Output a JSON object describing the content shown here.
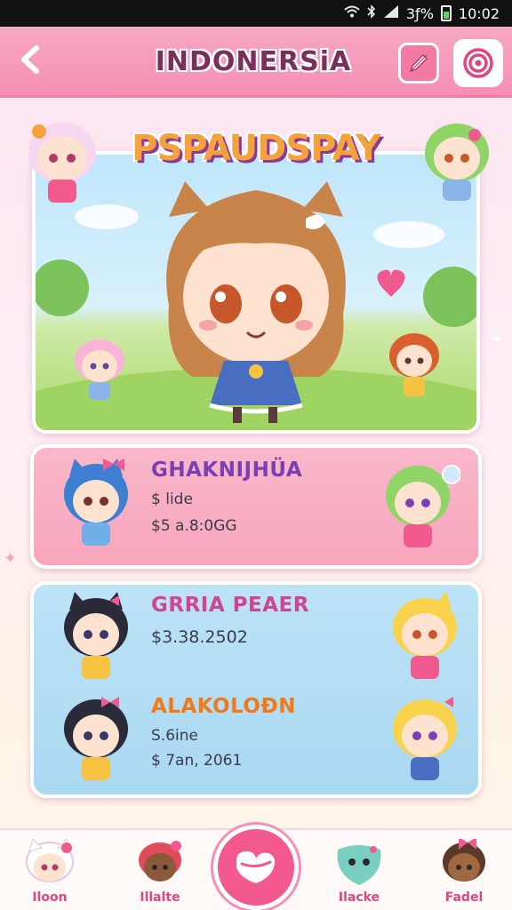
{
  "status_bar": {
    "battery_text": "3ƒ%",
    "time": "10:02",
    "wifi_icon": "wifi-icon",
    "bluetooth_icon": "bluetooth-icon",
    "signal_icon": "signal-icon"
  },
  "header": {
    "title": "INDONERSiA",
    "back_icon": "chevron-left-icon",
    "edit_icon": "pencil-icon",
    "target_icon": "target-icon"
  },
  "hero": {
    "title": "PSPAUDSPAY"
  },
  "entries": [
    {
      "name": "GHAKNIJHÜA",
      "line1": "$ lide",
      "line2": "$5 a.8:0GG",
      "card": "pink"
    },
    {
      "name": "GRRIA PEAER",
      "line1": "$3.38.2502",
      "line2": "",
      "card": "blue"
    },
    {
      "name": "ALAKOLOÐN",
      "line1": "S.6ine",
      "line2": "$ 7an, 2061",
      "card": "blue"
    }
  ],
  "bottom_nav": {
    "items": [
      {
        "label": "Iloon",
        "icon": "home-avatar-icon"
      },
      {
        "label": "Illalte",
        "icon": "friend-avatar-icon"
      },
      {
        "label": "",
        "icon": "heart-center-icon"
      },
      {
        "label": "Ilacke",
        "icon": "pet-icon"
      },
      {
        "label": "Fadel",
        "icon": "profile-avatar-icon"
      }
    ]
  },
  "colors": {
    "header_pink": "#f58fb3",
    "card_pink": "#f7a6bd",
    "card_blue": "#a9d8f1",
    "title_orange": "#f5a23c",
    "name_purple": "#7a3fb5",
    "name_pink": "#e0457f",
    "name_orange": "#f07a1a"
  }
}
